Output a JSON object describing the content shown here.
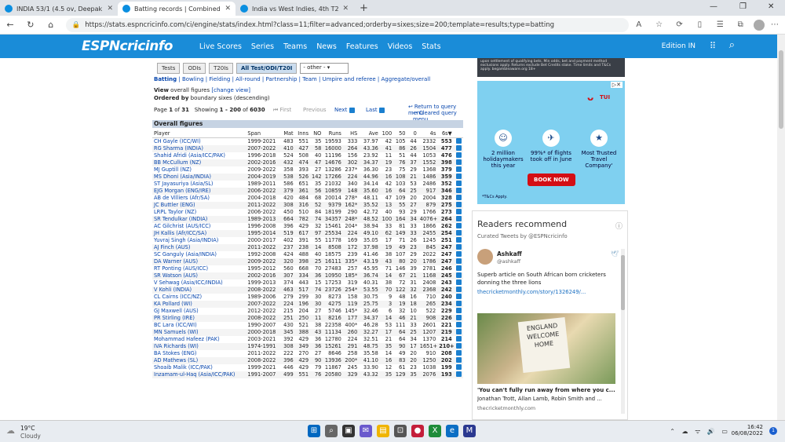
{
  "browser": {
    "tabs": [
      {
        "title": "INDIA 53/1 (4.5 ov, Deepak Hoo",
        "active": false
      },
      {
        "title": "Batting records | Combined Test",
        "active": true
      },
      {
        "title": "India vs West Indies, 4th T20I, La",
        "active": false
      }
    ],
    "new_tab": "+",
    "url": "https://stats.espncricinfo.com/ci/engine/stats/index.html?class=11;filter=advanced;orderby=sixes;size=200;template=results;type=batting",
    "window_controls": [
      "—",
      "❐",
      "✕"
    ]
  },
  "header": {
    "logo": "ESPNcricinfo",
    "nav": [
      "Live Scores",
      "Series",
      "Teams",
      "News",
      "Features",
      "Videos",
      "Stats"
    ],
    "edition": "Edition IN"
  },
  "stats_page": {
    "format_tabs": [
      "Tests",
      "ODIs",
      "T20Is",
      "All Test/ODI/T20I"
    ],
    "other_select": "- other -",
    "subnav": [
      "Batting",
      "Bowling",
      "Fielding",
      "All-round",
      "Partnership",
      "Team",
      "Umpire and referee",
      "Aggregate/overall"
    ],
    "view_label": "View",
    "view_text": "overall figures",
    "change_view": "[change view]",
    "ordered_label": "Ordered by",
    "ordered_text": "boundary sixes (descending)",
    "page_label": "Page",
    "page_current": "1",
    "page_of": "of",
    "page_total": "31",
    "showing_label": "Showing",
    "showing_range": "1 - 200",
    "showing_of": "of",
    "showing_total": "6030",
    "first": "First",
    "previous": "Previous",
    "next": "Next",
    "last": "Last",
    "return_link": "Return to query menu",
    "clear_link": "Cleared query menu",
    "section_title": "Overall figures",
    "columns": [
      "Player",
      "Span",
      "Mat",
      "Inns",
      "NO",
      "Runs",
      "HS",
      "Ave",
      "100",
      "50",
      "0",
      "4s",
      "6s▼"
    ],
    "rows": [
      [
        "CH Gayle (ICC/WI)",
        "1999-2021",
        "483",
        "551",
        "35",
        "19593",
        "333",
        "37.97",
        "42",
        "105",
        "44",
        "2332",
        "553"
      ],
      [
        "RG Sharma (INDIA)",
        "2007-2022",
        "410",
        "427",
        "58",
        "16000",
        "264",
        "43.36",
        "41",
        "86",
        "26",
        "1504",
        "477"
      ],
      [
        "Shahid Afridi (Asia/ICC/PAK)",
        "1996-2018",
        "524",
        "508",
        "40",
        "11196",
        "156",
        "23.92",
        "11",
        "51",
        "44",
        "1053",
        "476"
      ],
      [
        "BB McCullum (NZ)",
        "2002-2016",
        "432",
        "474",
        "47",
        "14676",
        "302",
        "34.37",
        "19",
        "76",
        "37",
        "1552",
        "398"
      ],
      [
        "MJ Guptill (NZ)",
        "2009-2022",
        "358",
        "393",
        "27",
        "13286",
        "237*",
        "36.30",
        "23",
        "75",
        "29",
        "1368",
        "379"
      ],
      [
        "MS Dhoni (Asia/INDIA)",
        "2004-2019",
        "538",
        "526",
        "142",
        "17266",
        "224",
        "44.96",
        "16",
        "108",
        "21",
        "1486",
        "359"
      ],
      [
        "ST Jayasuriya (Asia/SL)",
        "1989-2011",
        "586",
        "651",
        "35",
        "21032",
        "340",
        "34.14",
        "42",
        "103",
        "53",
        "2486",
        "352"
      ],
      [
        "EJG Morgan (ENG/IRE)",
        "2006-2022",
        "379",
        "361",
        "56",
        "10859",
        "148",
        "35.60",
        "16",
        "64",
        "25",
        "917",
        "346"
      ],
      [
        "AB de Villiers (Afr/SA)",
        "2004-2018",
        "420",
        "484",
        "68",
        "20014",
        "278*",
        "48.11",
        "47",
        "109",
        "20",
        "2004",
        "328"
      ],
      [
        "JC Buttler (ENG)",
        "2011-2022",
        "308",
        "316",
        "52",
        "9379",
        "162*",
        "35.52",
        "13",
        "55",
        "27",
        "879",
        "275"
      ],
      [
        "LRPL Taylor (NZ)",
        "2006-2022",
        "450",
        "510",
        "84",
        "18199",
        "290",
        "42.72",
        "40",
        "93",
        "29",
        "1766",
        "273"
      ],
      [
        "SR Tendulkar (INDIA)",
        "1989-2013",
        "664",
        "782",
        "74",
        "34357",
        "248*",
        "48.52",
        "100",
        "164",
        "34",
        "4076+",
        "264"
      ],
      [
        "AC Gilchrist (AUS/ICC)",
        "1996-2008",
        "396",
        "429",
        "32",
        "15461",
        "204*",
        "38.94",
        "33",
        "81",
        "33",
        "1866",
        "262"
      ],
      [
        "JH Kallis (Afr/ICC/SA)",
        "1995-2014",
        "519",
        "617",
        "97",
        "25534",
        "224",
        "49.10",
        "62",
        "149",
        "33",
        "2455",
        "254"
      ],
      [
        "Yuvraj Singh (Asia/INDIA)",
        "2000-2017",
        "402",
        "391",
        "55",
        "11778",
        "169",
        "35.05",
        "17",
        "71",
        "26",
        "1245",
        "251"
      ],
      [
        "AJ Finch (AUS)",
        "2011-2022",
        "237",
        "238",
        "14",
        "8508",
        "172",
        "37.98",
        "19",
        "49",
        "23",
        "845",
        "247"
      ],
      [
        "SC Ganguly (Asia/INDIA)",
        "1992-2008",
        "424",
        "488",
        "40",
        "18575",
        "239",
        "41.46",
        "38",
        "107",
        "29",
        "2022",
        "247"
      ],
      [
        "DA Warner (AUS)",
        "2009-2022",
        "320",
        "398",
        "25",
        "16111",
        "335*",
        "43.19",
        "43",
        "80",
        "20",
        "1786",
        "247"
      ],
      [
        "RT Ponting (AUS/ICC)",
        "1995-2012",
        "560",
        "668",
        "70",
        "27483",
        "257",
        "45.95",
        "71",
        "146",
        "39",
        "2781",
        "246"
      ],
      [
        "SR Watson (AUS)",
        "2002-2016",
        "307",
        "334",
        "36",
        "10950",
        "185*",
        "36.74",
        "14",
        "67",
        "21",
        "1168",
        "245"
      ],
      [
        "V Sehwag (Asia/ICC/INDIA)",
        "1999-2013",
        "374",
        "443",
        "15",
        "17253",
        "319",
        "40.31",
        "38",
        "72",
        "31",
        "2408",
        "243"
      ],
      [
        "V Kohli (INDIA)",
        "2008-2022",
        "463",
        "517",
        "74",
        "23726",
        "254*",
        "53.55",
        "70",
        "122",
        "32",
        "2368",
        "242"
      ],
      [
        "CL Cairns (ICC/NZ)",
        "1989-2006",
        "279",
        "299",
        "30",
        "8273",
        "158",
        "30.75",
        "9",
        "48",
        "16",
        "710",
        "240"
      ],
      [
        "KA Pollard (WI)",
        "2007-2022",
        "224",
        "196",
        "30",
        "4275",
        "119",
        "25.75",
        "3",
        "19",
        "18",
        "265",
        "234"
      ],
      [
        "GJ Maxwell (AUS)",
        "2012-2022",
        "215",
        "204",
        "27",
        "5746",
        "145*",
        "32.46",
        "6",
        "32",
        "10",
        "522",
        "229"
      ],
      [
        "PR Stirling (IRE)",
        "2008-2022",
        "251",
        "250",
        "11",
        "8216",
        "177",
        "34.37",
        "14",
        "46",
        "21",
        "908",
        "226"
      ],
      [
        "BC Lara (ICC/WI)",
        "1990-2007",
        "430",
        "521",
        "38",
        "22358",
        "400*",
        "46.28",
        "53",
        "111",
        "33",
        "2601",
        "221"
      ],
      [
        "MN Samuels (WI)",
        "2000-2018",
        "345",
        "388",
        "43",
        "11134",
        "260",
        "32.27",
        "17",
        "64",
        "25",
        "1207",
        "219"
      ],
      [
        "Mohammad Hafeez (PAK)",
        "2003-2021",
        "392",
        "429",
        "36",
        "12780",
        "224",
        "32.51",
        "21",
        "64",
        "34",
        "1370",
        "214"
      ],
      [
        "IVA Richards (WI)",
        "1974-1991",
        "308",
        "349",
        "36",
        "15261",
        "291",
        "48.75",
        "35",
        "90",
        "17",
        "1651+",
        "210+"
      ],
      [
        "BA Stokes (ENG)",
        "2011-2022",
        "222",
        "270",
        "27",
        "8646",
        "258",
        "35.58",
        "14",
        "49",
        "20",
        "910",
        "208"
      ],
      [
        "AD Mathews (SL)",
        "2008-2022",
        "396",
        "429",
        "90",
        "13936",
        "200*",
        "41.10",
        "16",
        "83",
        "20",
        "1250",
        "202"
      ],
      [
        "Shoaib Malik (ICC/PAK)",
        "1999-2021",
        "446",
        "429",
        "79",
        "11867",
        "245",
        "33.90",
        "12",
        "61",
        "23",
        "1038",
        "199"
      ],
      [
        "Inzamam-ul-Haq (Asia/ICC/PAK)",
        "1991-2007",
        "499",
        "551",
        "76",
        "20580",
        "329",
        "43.32",
        "35",
        "129",
        "35",
        "2076",
        "193"
      ]
    ]
  },
  "ad": {
    "top_text": "upon settlement of qualifying bets. Min odds, bet and payment method exclusions apply. Returns exclude Bet Credits stake. Time limits and T&Cs apply. begambleaware.org 18+",
    "brand": "TUI",
    "col1": "2 million holidaymakers this year",
    "col2": "99%* of flights took off in June",
    "col3": "Most Trusted Travel Company'",
    "cta": "BOOK NOW",
    "terms": "*T&Cs Apply."
  },
  "readers": {
    "title": "Readers recommend",
    "subtitle": "Curated Tweets by @ESPNcricinfo",
    "tweet1_name": "Ashkaff",
    "tweet1_handle": "@ashkaff",
    "tweet1_text": "Superb article on South African born cricketers donning the three lions",
    "tweet1_link": "thecricketmonthly.com/story/1326249/...",
    "sign_text": "ENGLAND WELCOME HOME",
    "tweet2_title": "'You can't fully run away from where you c...",
    "tweet2_text": "Jonathan Trott, Allan Lamb, Robin Smith and ...",
    "tweet2_link": "thecricketmonthly.com"
  },
  "taskbar": {
    "temp": "19°C",
    "weather": "Cloudy",
    "time": "16:42",
    "date": "06/08/2022",
    "notifications": "1"
  }
}
